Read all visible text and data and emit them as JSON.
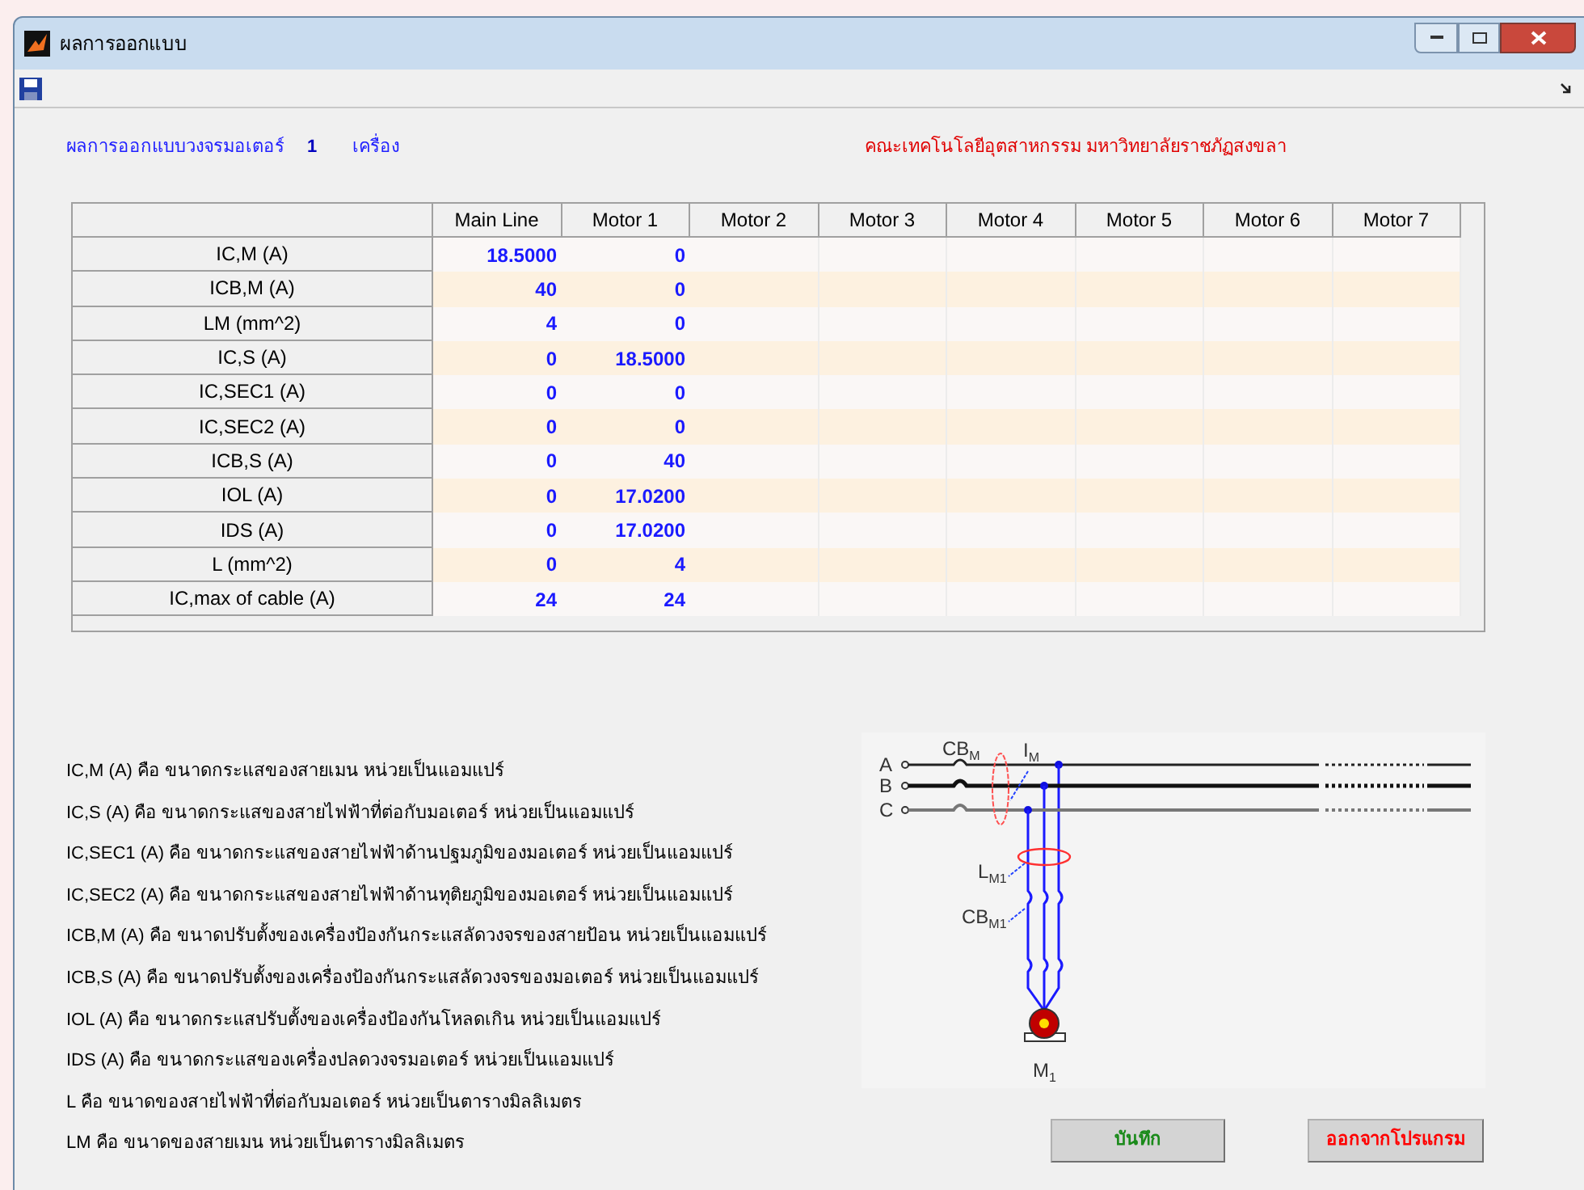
{
  "window": {
    "title": "ผลการออกแบบ"
  },
  "header": {
    "title": "ผลการออกแบบวงจรมอเตอร์",
    "count": "1",
    "unit": "เครื่อง",
    "organization": "คณะเทคโนโลยีอุตสาหกรรม มหาวิทยาลัยราชภัฏสงขลา"
  },
  "table": {
    "columns": [
      "Main Line",
      "Motor 1",
      "Motor 2",
      "Motor 3",
      "Motor 4",
      "Motor 5",
      "Motor 6",
      "Motor 7"
    ],
    "rows": [
      {
        "label": "IC,M (A)",
        "cells": [
          "18.5000",
          "0"
        ]
      },
      {
        "label": "ICB,M (A)",
        "cells": [
          "40",
          "0"
        ]
      },
      {
        "label": "LM (mm^2)",
        "cells": [
          "4",
          "0"
        ]
      },
      {
        "label": "IC,S (A)",
        "cells": [
          "0",
          "18.5000"
        ]
      },
      {
        "label": "IC,SEC1 (A)",
        "cells": [
          "0",
          "0"
        ]
      },
      {
        "label": "IC,SEC2 (A)",
        "cells": [
          "0",
          "0"
        ]
      },
      {
        "label": "ICB,S (A)",
        "cells": [
          "0",
          "40"
        ]
      },
      {
        "label": "IOL (A)",
        "cells": [
          "0",
          "17.0200"
        ]
      },
      {
        "label": "IDS (A)",
        "cells": [
          "0",
          "17.0200"
        ]
      },
      {
        "label": "L (mm^2)",
        "cells": [
          "0",
          "4"
        ]
      },
      {
        "label": "IC,max of cable (A)",
        "cells": [
          "24",
          "24"
        ]
      }
    ]
  },
  "definitions": [
    "IC,M (A) คือ ขนาดกระแสของสายเมน หน่วยเป็นแอมแปร์",
    "IC,S (A) คือ ขนาดกระแสของสายไฟฟ้าที่ต่อกับมอเตอร์ หน่วยเป็นแอมแปร์",
    "IC,SEC1 (A) คือ ขนาดกระแสของสายไฟฟ้าด้านปฐมภูมิของมอเตอร์ หน่วยเป็นแอมแปร์",
    "IC,SEC2 (A) คือ ขนาดกระแสของสายไฟฟ้าด้านทุติยภูมิของมอเตอร์ หน่วยเป็นแอมแปร์",
    "ICB,M (A) คือ ขนาดปรับตั้งของเครื่องป้องกันกระแสลัดวงจรของสายป้อน หน่วยเป็นแอมแปร์",
    "ICB,S (A) คือ ขนาดปรับตั้งของเครื่องป้องกันกระแสลัดวงจรของมอเตอร์ หน่วยเป็นแอมแปร์",
    "IOL (A) คือ ขนาดกระแสปรับตั้งของเครื่องป้องกันโหลดเกิน หน่วยเป็นแอมแปร์",
    "IDS (A) คือ ขนาดกระแสของเครื่องปลดวงจรมอเตอร์ หน่วยเป็นแอมแปร์",
    "L คือ ขนาดของสายไฟฟ้าที่ต่อกับมอเตอร์ หน่วยเป็นตารางมิลลิเมตร",
    "LM คือ ขนาดของสายเมน หน่วยเป็นตารางมิลลิเมตร"
  ],
  "diagram": {
    "phases": [
      "A",
      "B",
      "C"
    ],
    "labels": [
      {
        "text": "CB",
        "sub": "M"
      },
      {
        "text": "I",
        "sub": "M"
      },
      {
        "text": "L",
        "sub": "M1"
      },
      {
        "text": "CB",
        "sub": "M1"
      }
    ],
    "motor": {
      "text": "M",
      "sub": "1"
    }
  },
  "buttons": [
    {
      "label": "บันทึก",
      "kind": "save"
    },
    {
      "label": "ออกจากโปรแกรม",
      "kind": "exit"
    }
  ]
}
